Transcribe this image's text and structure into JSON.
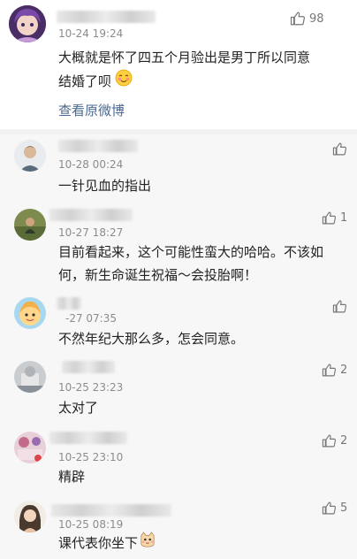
{
  "main": {
    "time": "10-24 19:24",
    "like_count": "98",
    "text_line1": "大概就是怀了四五个月验出是男丁所以同意",
    "text_line2": "结婚了呗",
    "view_original": "查看原微博"
  },
  "replies": [
    {
      "time": "10-28 00:24",
      "text": "一针见血的指出",
      "like_count": ""
    },
    {
      "time": "10-27 18:27",
      "text_line1": "目前看起来，这个可能性蛮大的哈哈。不该如",
      "text_line2": "何，新生命诞生祝福～会投胎啊！",
      "like_count": "1"
    },
    {
      "time": "-27 07:35",
      "text": "不然年纪大那么多，怎会同意。",
      "like_count": ""
    },
    {
      "time": "10-25 23:23",
      "text": "太对了",
      "like_count": "2"
    },
    {
      "time": "10-25 23:10",
      "text": "精辟",
      "like_count": "2"
    },
    {
      "time": "10-25 08:19",
      "text": "课代表你坐下",
      "like_count": "5"
    }
  ],
  "icons": {
    "thumbs_up": "thumbs-up-icon",
    "blush_emoji": "blush-emoji-icon",
    "cat_emoji": "cat-emoji-icon"
  },
  "colors": {
    "link": "#4a6a92",
    "time": "#8c8c8c",
    "reply_bg": "#f7f7f7"
  }
}
